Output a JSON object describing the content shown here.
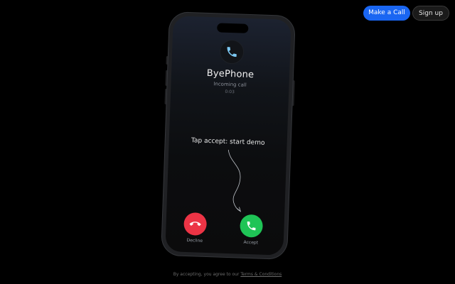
{
  "header": {
    "make_call_label": "Make a Call",
    "signup_label": "Sign up"
  },
  "call": {
    "caller_name": "ByePhone",
    "status": "Incoming call",
    "timer": "0:03",
    "hint": "Tap accept: start demo",
    "decline_label": "Decline",
    "accept_label": "Accept"
  },
  "footer": {
    "prefix": "By accepting, you agree to our ",
    "link_label": "Terms & Conditions"
  },
  "colors": {
    "accent": "#1a66f2",
    "decline": "#ec3445",
    "accept": "#1fc456",
    "background": "#000000"
  },
  "icons": {
    "caller": "phone-icon",
    "decline": "phone-hangup-icon",
    "accept": "phone-icon",
    "hint": "curved-arrow-icon"
  }
}
